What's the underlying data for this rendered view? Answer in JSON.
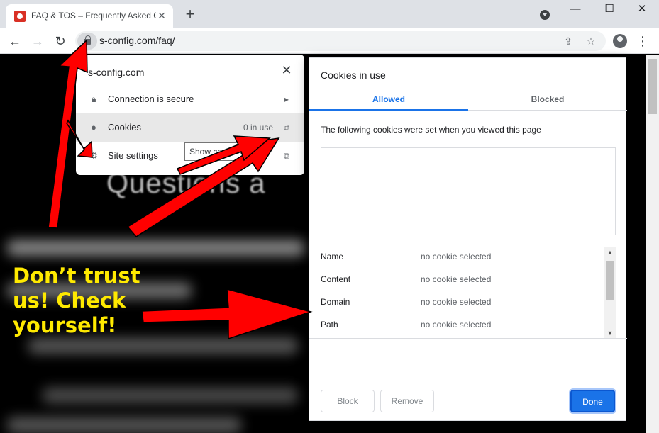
{
  "browser": {
    "tab_title": "FAQ & TOS – Frequently Asked C",
    "tab_close": "✕",
    "new_tab": "+",
    "window_minimize": "—",
    "window_maximize": "☐",
    "window_close": "✕",
    "url": "s-config.com/faq/"
  },
  "page": {
    "heading_fragment": "Questions a"
  },
  "site_popup": {
    "site": "s-config.com",
    "close_glyph": "✕",
    "rows": [
      {
        "label": "Connection is secure",
        "icon": "lock-icon",
        "trail": "▸"
      },
      {
        "label": "Cookies",
        "icon": "cookie-icon",
        "extra": "0 in use",
        "trail": "⧉"
      },
      {
        "label": "Site settings",
        "icon": "gear-icon",
        "trail": "⧉"
      }
    ],
    "tooltip": "Show cookies"
  },
  "cookies_dialog": {
    "title": "Cookies in use",
    "tabs": [
      "Allowed",
      "Blocked"
    ],
    "description": "The following cookies were set when you viewed this page",
    "details": [
      {
        "label": "Name",
        "value": "no cookie selected"
      },
      {
        "label": "Content",
        "value": "no cookie selected"
      },
      {
        "label": "Domain",
        "value": "no cookie selected"
      },
      {
        "label": "Path",
        "value": "no cookie selected"
      }
    ],
    "buttons": {
      "block": "Block",
      "remove": "Remove",
      "done": "Done"
    }
  },
  "annotation": {
    "text_lines": [
      "Don’t trust",
      "us! Check",
      "yourself!"
    ],
    "arrow_color": "#ff0000",
    "text_color": "#ffea00"
  }
}
